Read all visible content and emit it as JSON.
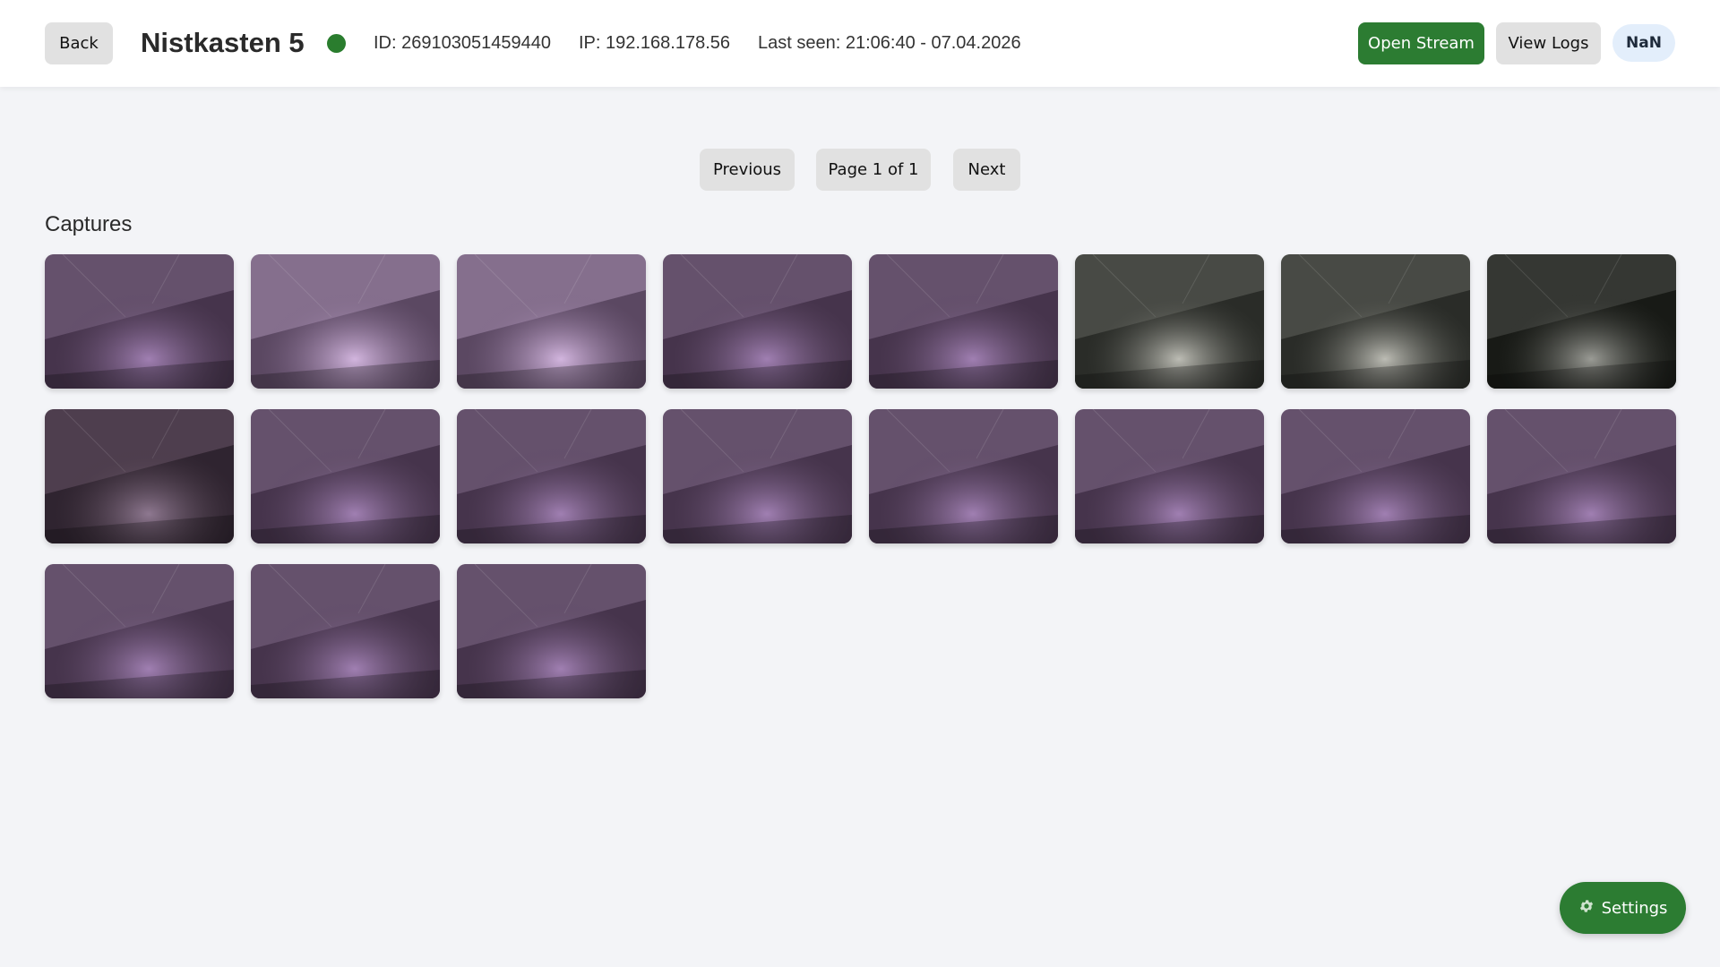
{
  "header": {
    "back_label": "Back",
    "title": "Nistkasten 5",
    "status_color": "#2a7d2e",
    "id_text": "ID: 269103051459440",
    "ip_text": "IP: 192.168.178.56",
    "last_seen_text": "Last seen: 21:06:40 - 07.04.2026",
    "open_stream_label": "Open Stream",
    "view_logs_label": "View Logs",
    "badge_text": "NaN"
  },
  "pagination": {
    "previous_label": "Previous",
    "page_text": "Page 1 of 1",
    "next_label": "Next"
  },
  "captures": {
    "heading": "Captures",
    "items": [
      {
        "tint": "purple"
      },
      {
        "tint": "light-purple"
      },
      {
        "tint": "light-purple"
      },
      {
        "tint": "purple"
      },
      {
        "tint": "purple"
      },
      {
        "tint": "grey"
      },
      {
        "tint": "grey"
      },
      {
        "tint": "dark-grey"
      },
      {
        "tint": "dark-purple"
      },
      {
        "tint": "purple"
      },
      {
        "tint": "purple"
      },
      {
        "tint": "purple"
      },
      {
        "tint": "purple"
      },
      {
        "tint": "purple"
      },
      {
        "tint": "purple"
      },
      {
        "tint": "purple"
      },
      {
        "tint": "purple"
      },
      {
        "tint": "purple"
      },
      {
        "tint": "purple"
      }
    ]
  },
  "settings": {
    "label": "Settings",
    "icon": "gear-icon"
  },
  "colors": {
    "accent_green": "#2c7c32",
    "button_grey": "#e1e1e1",
    "background": "#f3f4f7"
  }
}
